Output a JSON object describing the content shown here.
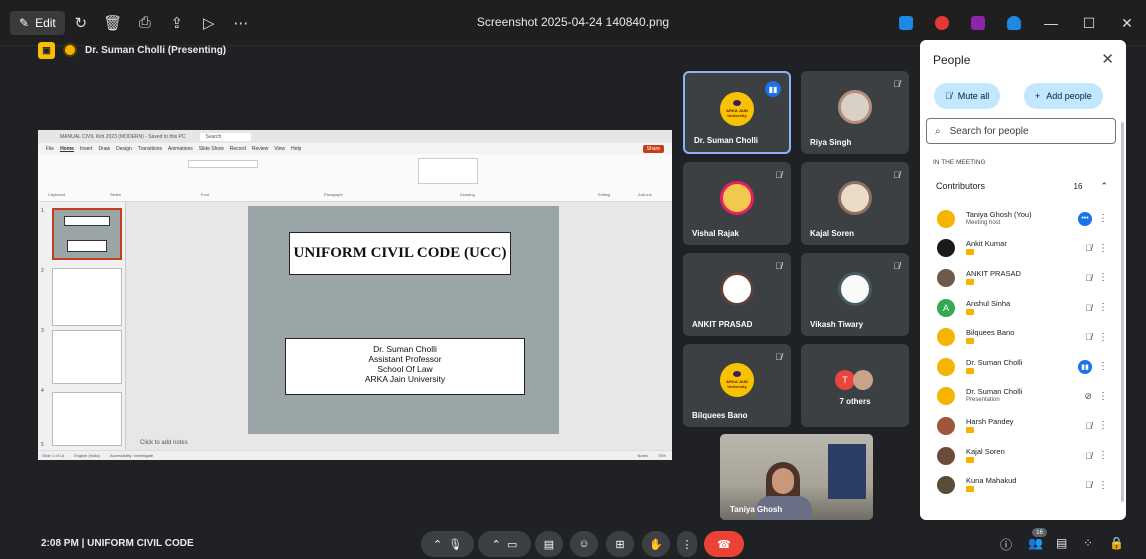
{
  "viewer": {
    "edit_label": "Edit",
    "file_title": "Screenshot 2025-04-24 140840.png",
    "icons": [
      "rotate-icon",
      "delete-icon",
      "print-icon",
      "share-icon",
      "slideshow-icon",
      "more-icon"
    ]
  },
  "presenting": {
    "text": "Dr. Suman Cholli (Presenting)"
  },
  "powerpoint": {
    "doc_title": "MANUAL CIVIL Kirti 2023 (MODERN) - Saved to this PC",
    "search_placeholder": "Search",
    "menu": [
      "File",
      "Home",
      "Insert",
      "Draw",
      "Design",
      "Transitions",
      "Animations",
      "Slide Show",
      "Record",
      "Review",
      "View",
      "Help"
    ],
    "share_label": "Share",
    "ribbon_groups": [
      "Clipboard",
      "Slides",
      "Font",
      "Paragraph",
      "Drawing",
      "Editing",
      "Add-ins"
    ],
    "slide_numbers": [
      "1",
      "2",
      "3",
      "4",
      "5"
    ],
    "slide": {
      "title": "UNIFORM CIVIL CODE (UCC)",
      "lines": [
        "Dr. Suman Cholli",
        "Assistant Professor",
        "School Of Law",
        "ARKA Jain University"
      ]
    },
    "notes_placeholder": "Click to add notes",
    "status_left": "Slide 1 of 14",
    "status_lang": "English (India)",
    "status_access": "Accessibility: Investigate",
    "status_notes": "Notes",
    "zoom": "76%"
  },
  "tiles": [
    {
      "name": "Dr. Suman Cholli",
      "avatar": "logo",
      "speaking": true
    },
    {
      "name": "Riya Singh",
      "avatar": "photo",
      "muted": true
    },
    {
      "name": "Vishal Rajak",
      "avatar": "photo",
      "muted": true
    },
    {
      "name": "Kajal Soren",
      "avatar": "photo",
      "muted": true
    },
    {
      "name": "ANKIT PRASAD",
      "avatar": "photo",
      "muted": true
    },
    {
      "name": "Vikash Tiwary",
      "avatar": "photo",
      "muted": true
    },
    {
      "name": "Bilquees Bano",
      "avatar": "logo",
      "muted": true
    },
    {
      "name": "7 others",
      "avatar": "group"
    }
  ],
  "self_view": {
    "name": "Taniya Ghosh"
  },
  "avatar_logo_text": [
    "ARKA JAIN",
    "University"
  ],
  "people_panel": {
    "title": "People",
    "mute_all": "Mute all",
    "add_people": "Add people",
    "search_placeholder": "Search for people",
    "section": "IN THE MEETING",
    "group_label": "Contributors",
    "group_count": "16",
    "people": [
      {
        "name": "Taniya Ghosh (You)",
        "sub": "Meeting host",
        "status": "more-dots",
        "color": "#f4b400"
      },
      {
        "name": "Ankit Kumar",
        "status": "mic-off",
        "color": "#1a1a1a"
      },
      {
        "name": "ANKIT PRASAD",
        "status": "mic-off",
        "color": "#6d5a4a"
      },
      {
        "name": "Anshul Sinha",
        "status": "mic-off",
        "color": "#34a853",
        "initial": "A"
      },
      {
        "name": "Bilquees Bano",
        "status": "mic-off",
        "color": "#f4b400"
      },
      {
        "name": "Dr. Suman Cholli",
        "status": "speaking",
        "color": "#f4b400"
      },
      {
        "name": "Dr. Suman Cholli",
        "sub": "Presentation",
        "status": "present-off",
        "color": "#f4b400"
      },
      {
        "name": "Harsh Pandey",
        "status": "mic-off",
        "color": "#a0563a"
      },
      {
        "name": "Kajal Soren",
        "status": "mic-off",
        "color": "#6d4a3a"
      },
      {
        "name": "Kuna Mahakud",
        "status": "mic-off",
        "color": "#5a4b3b"
      }
    ]
  },
  "bottom": {
    "time": "2:08 PM",
    "separator": "|",
    "meeting": "UNIFORM CIVIL CODE",
    "people_count": "16"
  },
  "colors": {
    "accent": "#8ab4f8",
    "pill": "#c2e7ff",
    "end_call": "#ea4335",
    "speaking": "#1a73e8"
  }
}
